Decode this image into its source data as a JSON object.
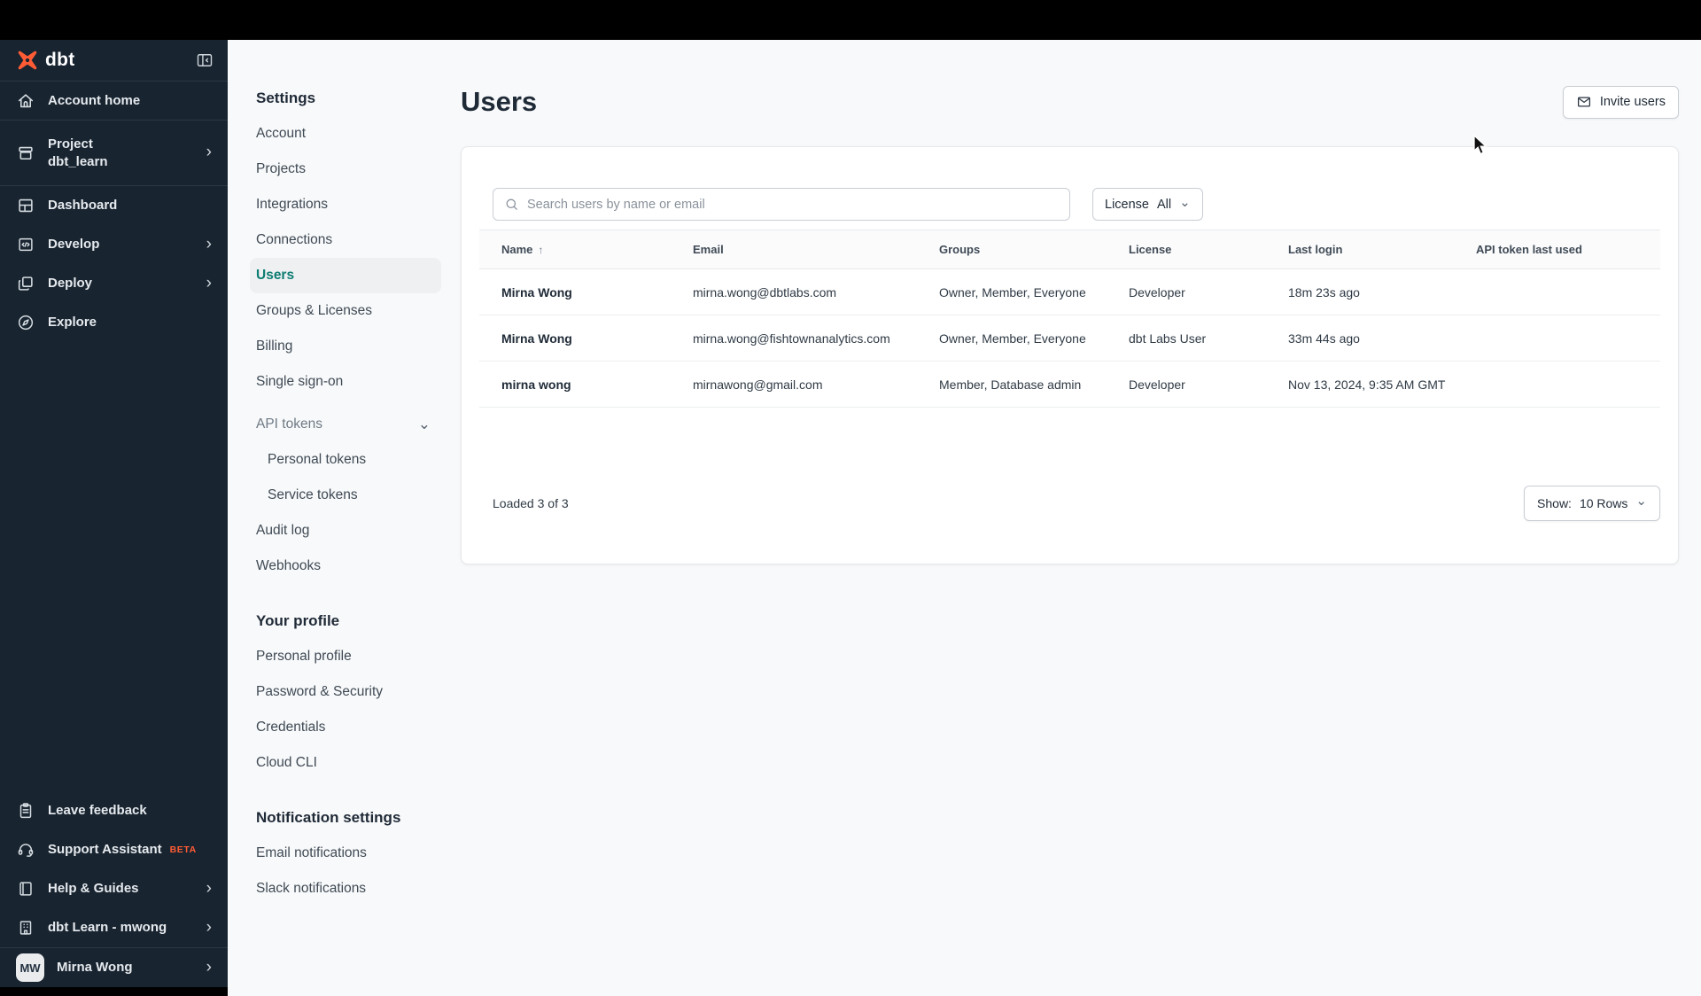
{
  "colors": {
    "topbar_bg": "#000000",
    "sidebar_bg": "#182430",
    "accent_orange": "#ff5c35",
    "active_teal": "#0e7d72",
    "page_bg": "#f8f9fa",
    "card_bg": "#ffffff"
  },
  "icons": {
    "chevron_right": "›",
    "chevron_down": "⌄",
    "sort_asc": "↑"
  },
  "sidebar": {
    "logo_text": "dbt",
    "nav": [
      {
        "label": "Account home"
      },
      {
        "label": "Project",
        "sublabel": "dbt_learn"
      },
      {
        "label": "Dashboard"
      },
      {
        "label": "Develop"
      },
      {
        "label": "Deploy"
      },
      {
        "label": "Explore"
      }
    ],
    "footer_nav": [
      {
        "label": "Leave feedback"
      },
      {
        "label": "Support Assistant",
        "badge": "BETA"
      },
      {
        "label": "Help & Guides"
      },
      {
        "label": "dbt Learn - mwong"
      }
    ],
    "user": {
      "initials": "MW",
      "name": "Mirna Wong"
    }
  },
  "settings_nav": {
    "settings_heading": "Settings",
    "items": [
      "Account",
      "Projects",
      "Integrations",
      "Connections",
      "Users",
      "Groups & Licenses",
      "Billing",
      "Single sign-on"
    ],
    "api_tokens_label": "API tokens",
    "api_sub_items": [
      "Personal tokens",
      "Service tokens"
    ],
    "more_items": [
      "Audit log",
      "Webhooks"
    ],
    "profile_heading": "Your profile",
    "profile_items": [
      "Personal profile",
      "Password & Security",
      "Credentials",
      "Cloud CLI"
    ],
    "notifications_heading": "Notification settings",
    "notification_items": [
      "Email notifications",
      "Slack notifications"
    ]
  },
  "main": {
    "title": "Users",
    "invite_button_label": "Invite users",
    "search_placeholder": "Search users by name or email",
    "license_filter": {
      "label": "License",
      "value": "All"
    },
    "table": {
      "columns": [
        "Name",
        "Email",
        "Groups",
        "License",
        "Last login",
        "API token last used"
      ],
      "rows": [
        {
          "name": "Mirna Wong",
          "email": "mirna.wong@dbtlabs.com",
          "groups": "Owner, Member, Everyone",
          "license": "Developer",
          "last_login": "18m 23s ago",
          "api_token_last_used": ""
        },
        {
          "name": "Mirna Wong",
          "email": "mirna.wong@fishtownanalytics.com",
          "groups": "Owner, Member, Everyone",
          "license": "dbt Labs User",
          "last_login": "33m 44s ago",
          "api_token_last_used": ""
        },
        {
          "name": "mirna wong",
          "email": "mirnawong@gmail.com",
          "groups": "Member, Database admin",
          "license": "Developer",
          "last_login": "Nov 13, 2024, 9:35 AM GMT",
          "api_token_last_used": ""
        }
      ]
    },
    "footer": {
      "loaded_text": "Loaded 3 of 3",
      "show_label": "Show:",
      "show_value": "10 Rows"
    }
  }
}
